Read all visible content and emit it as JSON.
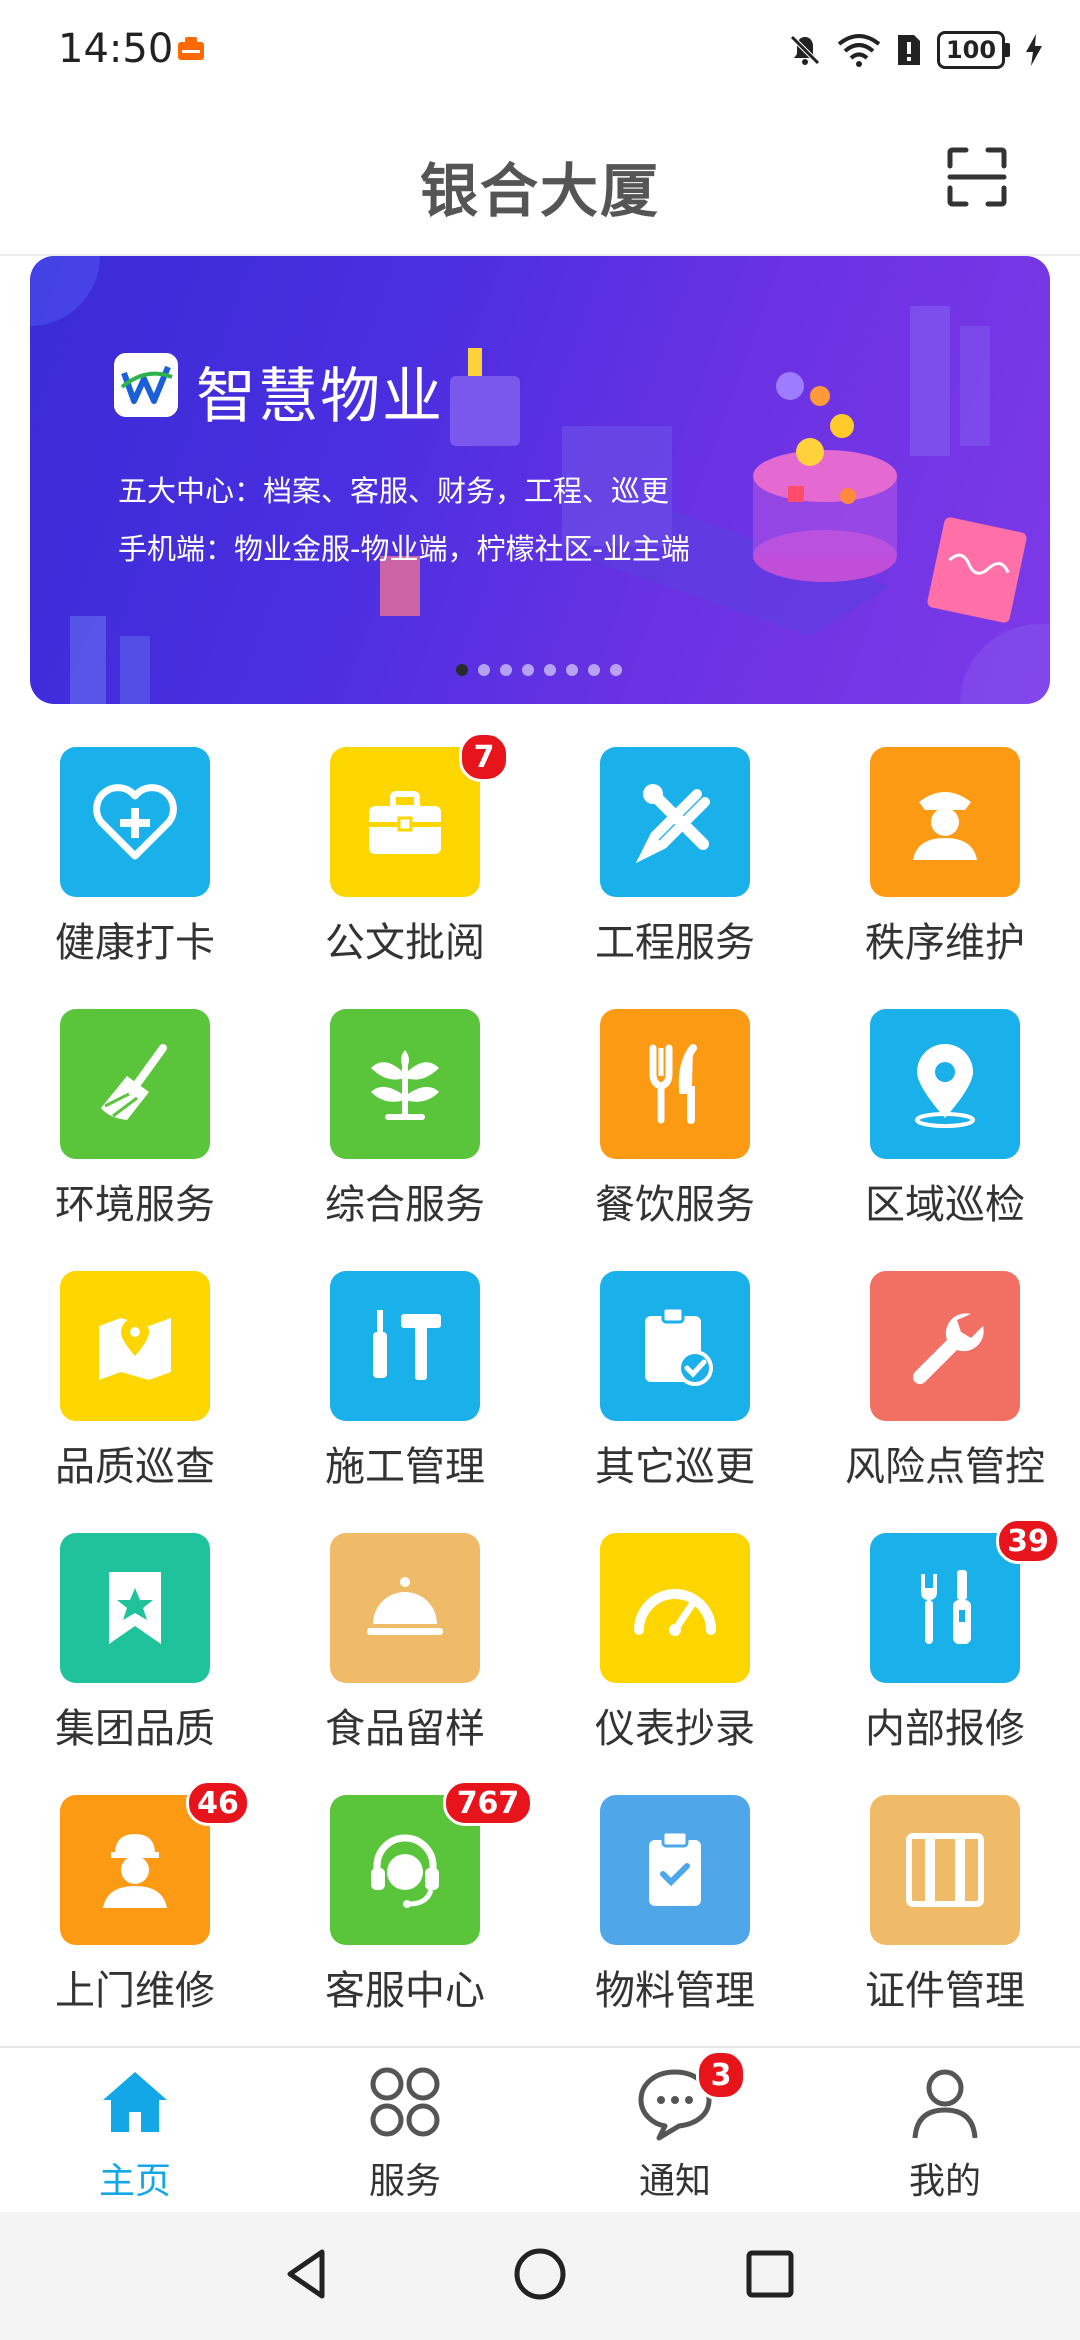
{
  "status_bar": {
    "time": "14:50",
    "battery": "100"
  },
  "header": {
    "title": "银合大厦"
  },
  "banner": {
    "title": "智慧物业",
    "line1": "五大中心：档案、客服、财务，工程、巡更",
    "line2": "手机端：物业金服-物业端，柠檬社区-业主端",
    "active_slide": 1,
    "slide_count": 8
  },
  "grid": {
    "items": [
      {
        "label": "健康打卡",
        "icon": "heart-plus-icon",
        "color": "#1ab0ea",
        "badge": ""
      },
      {
        "label": "公文批阅",
        "icon": "briefcase-icon",
        "color": "#fdd600",
        "badge": "7"
      },
      {
        "label": "工程服务",
        "icon": "tools-icon",
        "color": "#1ab0ea",
        "badge": ""
      },
      {
        "label": "秩序维护",
        "icon": "security-guard-icon",
        "color": "#fd9a14",
        "badge": ""
      },
      {
        "label": "环境服务",
        "icon": "broom-icon",
        "color": "#5ac43a",
        "badge": ""
      },
      {
        "label": "综合服务",
        "icon": "plant-icon",
        "color": "#5ac43a",
        "badge": ""
      },
      {
        "label": "餐饮服务",
        "icon": "fork-knife-icon",
        "color": "#fd9a14",
        "badge": ""
      },
      {
        "label": "区域巡检",
        "icon": "location-pin-icon",
        "color": "#1ab0ea",
        "badge": ""
      },
      {
        "label": "品质巡查",
        "icon": "map-pin-icon",
        "color": "#fdd600",
        "badge": ""
      },
      {
        "label": "施工管理",
        "icon": "hammer-screwdriver-icon",
        "color": "#1ab0ea",
        "badge": ""
      },
      {
        "label": "其它巡更",
        "icon": "clipboard-check-icon",
        "color": "#1ab0ea",
        "badge": ""
      },
      {
        "label": "风险点管控",
        "icon": "wrench-icon",
        "color": "#f26f63",
        "badge": ""
      },
      {
        "label": "集团品质",
        "icon": "bookmark-star-icon",
        "color": "#1fc29b",
        "badge": ""
      },
      {
        "label": "食品留样",
        "icon": "food-cloche-icon",
        "color": "#f0bb68",
        "badge": ""
      },
      {
        "label": "仪表抄录",
        "icon": "gauge-icon",
        "color": "#fdd600",
        "badge": ""
      },
      {
        "label": "内部报修",
        "icon": "repair-tools-icon",
        "color": "#1ab0ea",
        "badge": "39"
      },
      {
        "label": "上门维修",
        "icon": "worker-icon",
        "color": "#fd9a14",
        "badge": "46"
      },
      {
        "label": "客服中心",
        "icon": "headset-icon",
        "color": "#5ac43a",
        "badge": "767"
      },
      {
        "label": "物料管理",
        "icon": "clipboard-icon",
        "color": "#4fa7ea",
        "badge": ""
      },
      {
        "label": "证件管理",
        "icon": "document-card-icon",
        "color": "#f0bb68",
        "badge": ""
      }
    ]
  },
  "bottom_nav": {
    "items": [
      {
        "label": "主页",
        "icon": "home-icon",
        "active": true,
        "badge": ""
      },
      {
        "label": "服务",
        "icon": "grid-icon",
        "active": false,
        "badge": ""
      },
      {
        "label": "通知",
        "icon": "chat-bubble-icon",
        "active": false,
        "badge": "3"
      },
      {
        "label": "我的",
        "icon": "user-icon",
        "active": false,
        "badge": ""
      }
    ]
  },
  "colors": {
    "accent": "#13a7e8",
    "badge": "#e8141b"
  }
}
